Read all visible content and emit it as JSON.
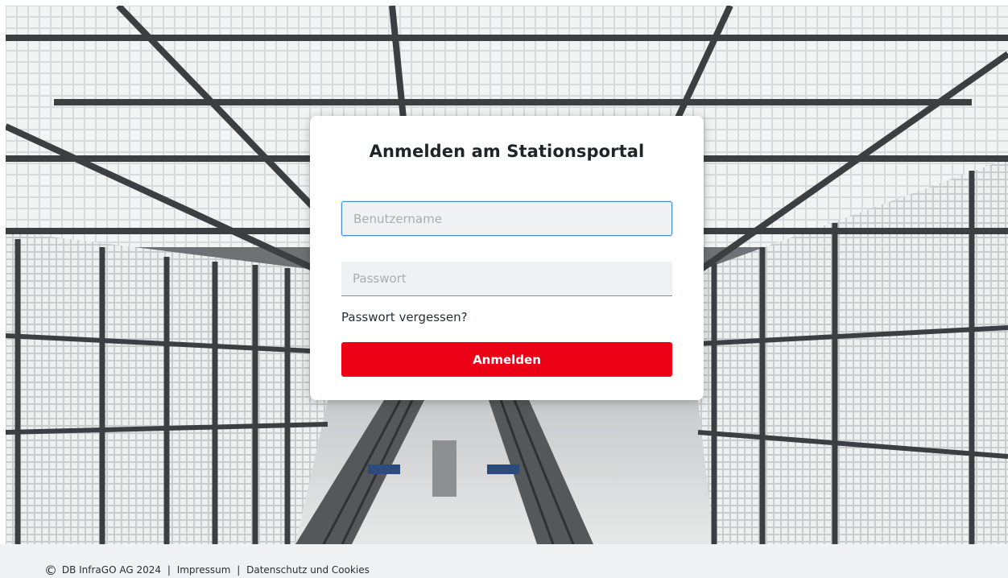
{
  "login": {
    "title": "Anmelden am Stationsportal",
    "username_placeholder": "Benutzername",
    "username_value": "",
    "password_placeholder": "Passwort",
    "password_value": "",
    "forgot_label": "Passwort vergessen?",
    "submit_label": "Anmelden"
  },
  "footer": {
    "copyright_symbol": "©",
    "company": "DB InfraGO AG 2024",
    "separator": "|",
    "impressum": "Impressum",
    "privacy": "Datenschutz und Cookies"
  },
  "colors": {
    "accent": "#ec0016",
    "focus_border": "#3e8fd1",
    "footer_bg": "#f0f1f2"
  }
}
